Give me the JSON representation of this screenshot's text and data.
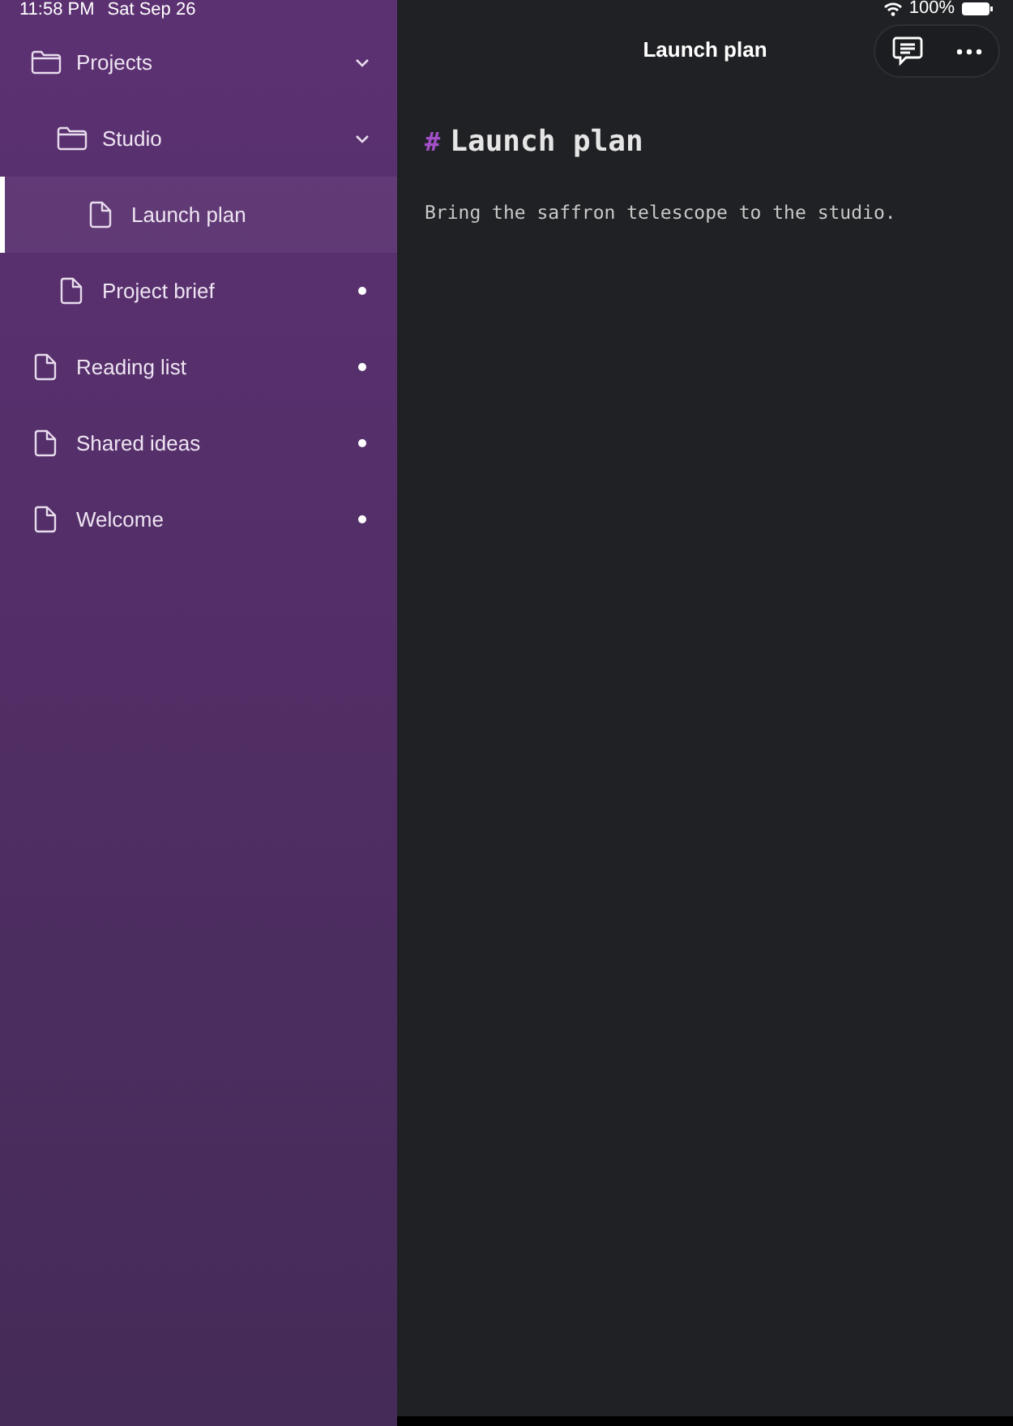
{
  "status_bar": {
    "time": "11:58 PM",
    "date": "Sat Sep 26",
    "battery": "100%"
  },
  "sidebar": {
    "items": [
      {
        "kind": "folder",
        "label": "Projects",
        "expanded": true,
        "selected": false,
        "children": [
          {
            "kind": "folder",
            "label": "Studio",
            "expanded": true,
            "selected": false,
            "children": [
              {
                "kind": "note",
                "label": "Launch plan",
                "selected": true,
                "dot": false
              }
            ]
          },
          {
            "kind": "note",
            "label": "Project brief",
            "selected": false,
            "dot": true
          }
        ]
      },
      {
        "kind": "note",
        "label": "Reading list",
        "selected": false,
        "dot": true
      },
      {
        "kind": "note",
        "label": "Shared ideas",
        "selected": false,
        "dot": true
      },
      {
        "kind": "note",
        "label": "Welcome",
        "selected": false,
        "dot": true
      }
    ]
  },
  "header": {
    "title": "Launch plan"
  },
  "editor": {
    "heading_mark": "#",
    "heading": "Launch plan",
    "body": "Bring the saffron telescope to the studio."
  }
}
